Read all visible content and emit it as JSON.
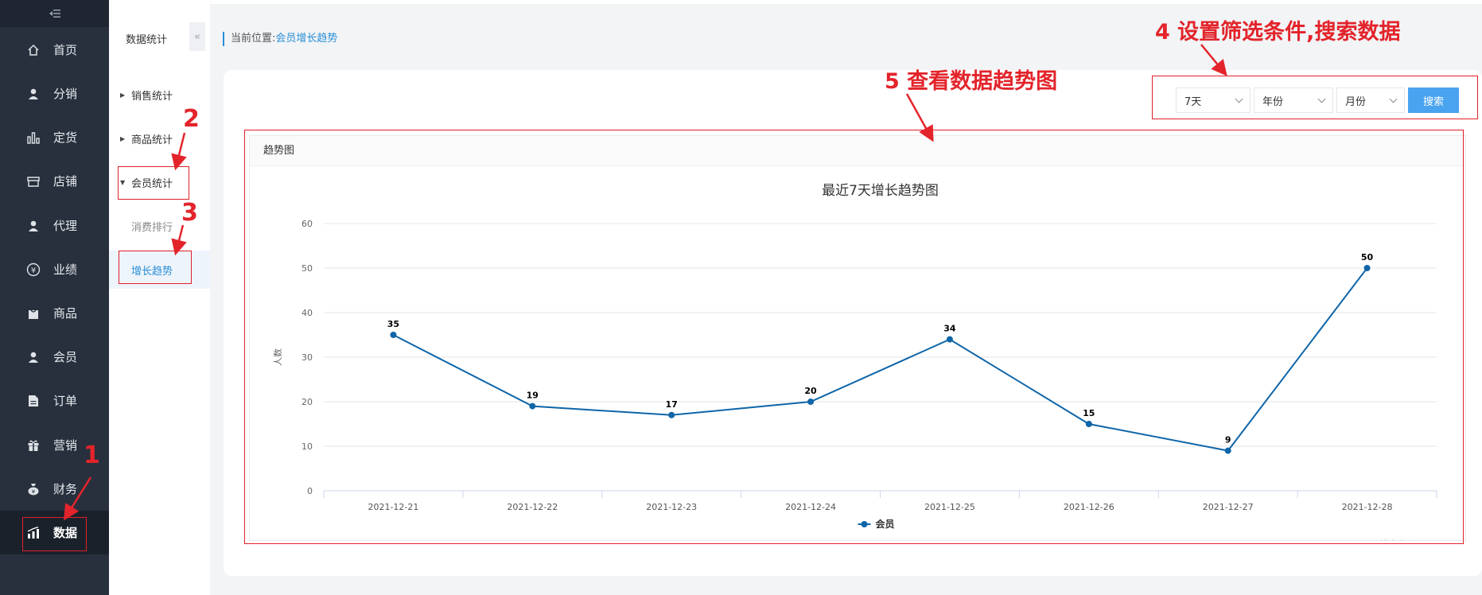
{
  "sidebar": {
    "collapse_icon": "menu-collapse-icon",
    "items": [
      {
        "label": "首页",
        "icon": "home-icon"
      },
      {
        "label": "分销",
        "icon": "user-icon"
      },
      {
        "label": "定货",
        "icon": "bar-chart-icon"
      },
      {
        "label": "店铺",
        "icon": "store-icon"
      },
      {
        "label": "代理",
        "icon": "user-icon"
      },
      {
        "label": "业绩",
        "icon": "yen-icon"
      },
      {
        "label": "商品",
        "icon": "bag-icon"
      },
      {
        "label": "会员",
        "icon": "user-icon"
      },
      {
        "label": "订单",
        "icon": "document-icon"
      },
      {
        "label": "营销",
        "icon": "gift-icon"
      },
      {
        "label": "财务",
        "icon": "money-bag-icon"
      },
      {
        "label": "数据",
        "icon": "stats-icon"
      }
    ],
    "active_index": 11
  },
  "submenu": {
    "title": "数据统计",
    "toggle": "«",
    "items": [
      {
        "label": "销售统计"
      },
      {
        "label": "商品统计"
      },
      {
        "label": "会员统计"
      },
      {
        "label": "消费排行"
      },
      {
        "label": "增长趋势"
      }
    ]
  },
  "breadcrumb": {
    "prefix": "当前位置:",
    "current": "会员增长趋势"
  },
  "filters": {
    "range": "7天",
    "year": "年份",
    "month": "月份",
    "search_label": "搜索"
  },
  "panel_title": "趋势图",
  "annotations": {
    "a1": "1",
    "a2": "2",
    "a3": "3",
    "a4": "4 设置筛选条件,搜索数据",
    "a5": "5 查看数据趋势图"
  },
  "colors": {
    "accent": "#2a8fd6",
    "line": "#0e65a8",
    "annotation": "#e3242b",
    "sidebar": "#28303d"
  },
  "chart_data": {
    "type": "line",
    "title": "最近7天增长趋势图",
    "ylabel": "人数",
    "xlabel": "",
    "ylim": [
      0,
      60
    ],
    "yticks": [
      0,
      10,
      20,
      30,
      40,
      50,
      60
    ],
    "categories": [
      "2021-12-21",
      "2021-12-22",
      "2021-12-23",
      "2021-12-24",
      "2021-12-25",
      "2021-12-26",
      "2021-12-27",
      "2021-12-28"
    ],
    "series": [
      {
        "name": "会员",
        "values": [
          35,
          19,
          17,
          20,
          34,
          15,
          9,
          50
        ]
      }
    ],
    "legend": "bottom-center",
    "credit": "Highcharts.com",
    "grid": true
  }
}
